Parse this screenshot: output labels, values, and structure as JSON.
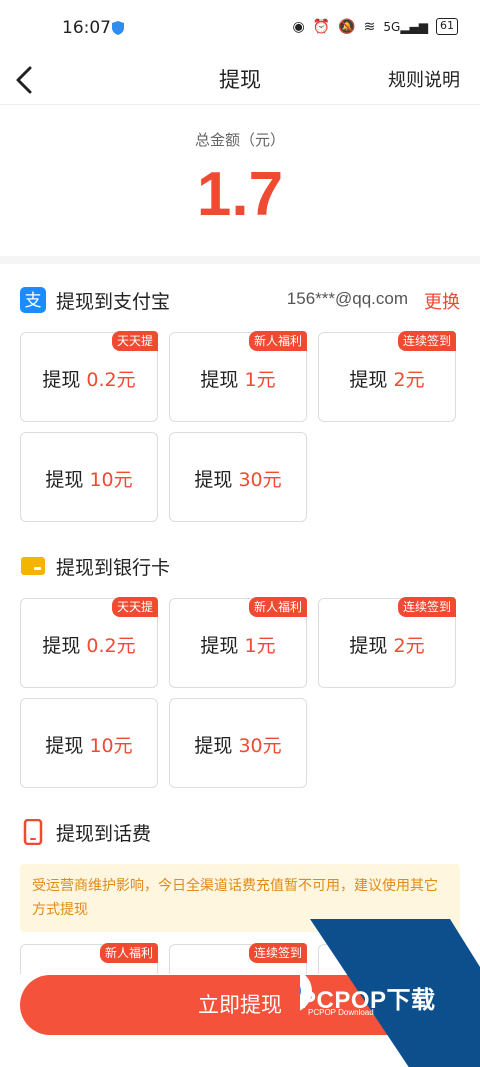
{
  "status_bar": {
    "time": "16:07",
    "battery": "61",
    "network": "5G"
  },
  "nav": {
    "title": "提现",
    "rules_label": "规则说明"
  },
  "summary": {
    "label": "总金额（元）",
    "amount": "1.7"
  },
  "sections": {
    "alipay": {
      "title": "提现到支付宝",
      "account": "156***@qq.com",
      "change_label": "更换",
      "options": [
        {
          "prefix": "提现",
          "amount": "0.2元",
          "tag": "天天提"
        },
        {
          "prefix": "提现",
          "amount": "1元",
          "tag": "新人福利"
        },
        {
          "prefix": "提现",
          "amount": "2元",
          "tag": "连续签到"
        },
        {
          "prefix": "提现",
          "amount": "10元",
          "tag": ""
        },
        {
          "prefix": "提现",
          "amount": "30元",
          "tag": ""
        }
      ]
    },
    "bank": {
      "title": "提现到银行卡",
      "options": [
        {
          "prefix": "提现",
          "amount": "0.2元",
          "tag": "天天提"
        },
        {
          "prefix": "提现",
          "amount": "1元",
          "tag": "新人福利"
        },
        {
          "prefix": "提现",
          "amount": "2元",
          "tag": "连续签到"
        },
        {
          "prefix": "提现",
          "amount": "10元",
          "tag": ""
        },
        {
          "prefix": "提现",
          "amount": "30元",
          "tag": ""
        }
      ]
    },
    "phone": {
      "title": "提现到话费",
      "notice": "受运营商维护影响，今日全渠道话费充值暂不可用，建议使用其它方式提现",
      "tags": [
        "新人福利",
        "连续签到"
      ]
    }
  },
  "submit_label": "立即提现",
  "watermark": {
    "text": "PCPOP下载",
    "sub": "PCPOP Download"
  },
  "colors": {
    "accent": "#f04a33",
    "alipay": "#1a8cff",
    "bank": "#f5b400",
    "phone": "#f04a33"
  }
}
